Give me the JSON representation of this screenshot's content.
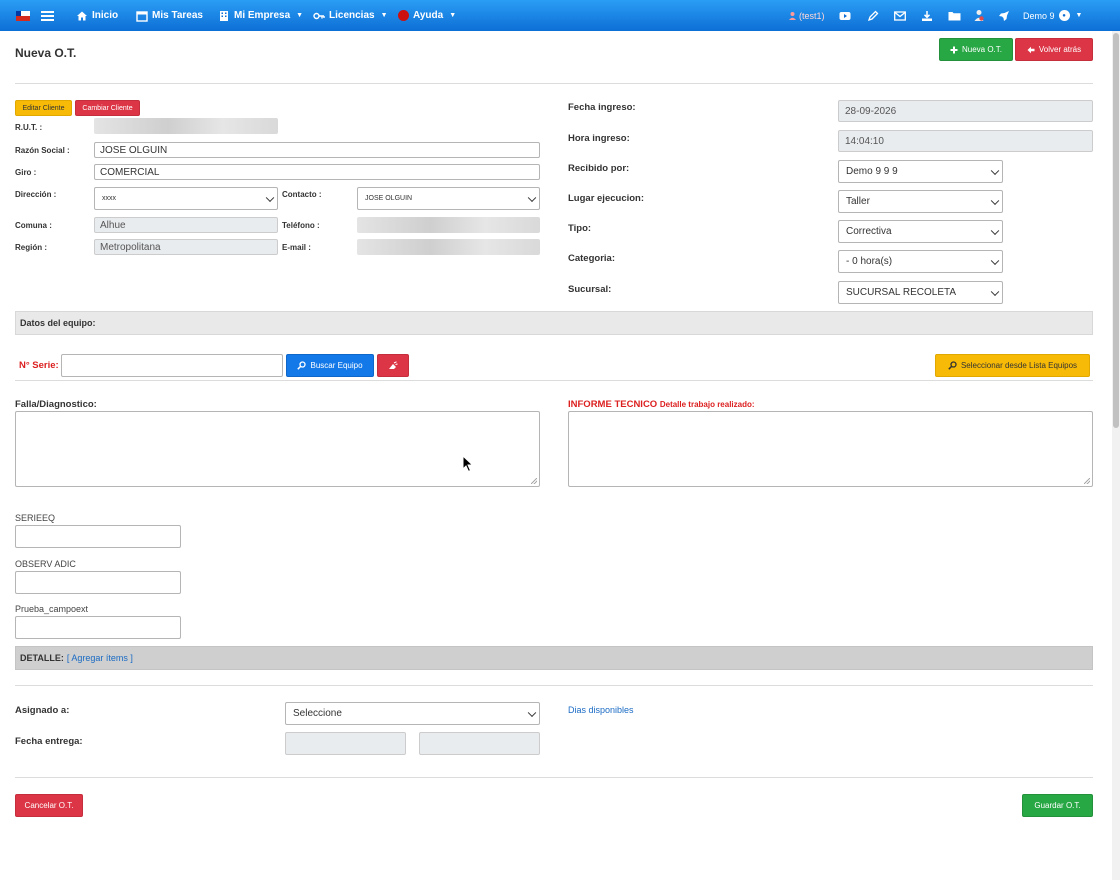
{
  "nav": {
    "inicio": "Inicio",
    "mis_tareas": "Mis Tareas",
    "mi_empresa": "Mi Empresa",
    "licencias": "Licencias",
    "ayuda": "Ayuda",
    "test_label": "(test1)",
    "user_label": "Demo 9"
  },
  "header": {
    "title": "Nueva O.T.",
    "nueva_ot_btn": "Nueva O.T.",
    "volver_btn": "Volver atrás"
  },
  "cliente": {
    "editar_btn": "Editar Cliente",
    "cambiar_btn": "Cambiar Cliente",
    "rut_label": "R.U.T. :",
    "razon_label": "Razón Social :",
    "razon_value": "JOSE OLGUIN",
    "giro_label": "Giro :",
    "giro_value": "COMERCIAL",
    "direccion_label": "Dirección :",
    "direccion_value": "xxxx",
    "contacto_label": "Contacto :",
    "contacto_value": "JOSE OLGUIN",
    "comuna_label": "Comuna :",
    "comuna_value": "Alhue",
    "telefono_label": "Teléfono :",
    "region_label": "Región :",
    "region_value": "Metropolitana",
    "email_label": "E-mail :"
  },
  "ot": {
    "fecha_ingreso_label": "Fecha ingreso:",
    "fecha_ingreso_value": "28-09-2026",
    "hora_ingreso_label": "Hora ingreso:",
    "hora_ingreso_value": "14:04:10",
    "recibido_label": "Recibido por:",
    "recibido_value": "Demo 9 9 9",
    "lugar_label": "Lugar ejecucion:",
    "lugar_value": "Taller",
    "tipo_label": "Tipo:",
    "tipo_value": "Correctiva",
    "categoria_label": "Categoria:",
    "categoria_value": "- 0 hora(s)",
    "sucursal_label": "Sucursal:",
    "sucursal_value": "SUCURSAL RECOLETA"
  },
  "equipo": {
    "section_title": "Datos del equipo:",
    "serie_label": "N° Serie:",
    "buscar_btn": "Buscar Equipo",
    "seleccionar_btn": "Seleccionar desde Lista Equipos"
  },
  "diagnostico": {
    "falla_label": "Falla/Diagnostico:",
    "informe_label": "INFORME TECNICO",
    "informe_sub": "Detalle trabajo realizado:"
  },
  "extra": {
    "serieeq_label": "SERIEEQ",
    "observ_label": "OBSERV ADIC",
    "prueba_label": "Prueba_campoext"
  },
  "detalle": {
    "label": "DETALLE:",
    "agregar_link": "[ Agregar ítems ]"
  },
  "asignacion": {
    "asignado_label": "Asignado a:",
    "asignado_value": "Seleccione",
    "dias_link": "Dias disponibles",
    "fecha_entrega_label": "Fecha entrega:"
  },
  "footer": {
    "cancelar_btn": "Cancelar O.T.",
    "guardar_btn": "Guardar O.T."
  },
  "colors": {
    "navbar": "#1479e8",
    "green": "#28a745",
    "red": "#dc3545",
    "yellow": "#f7bb07",
    "blue": "#1479e8"
  }
}
